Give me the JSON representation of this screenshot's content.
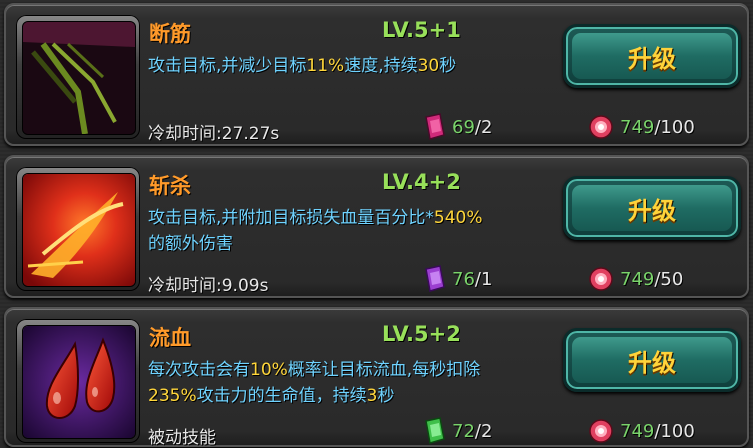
{
  "skills": [
    {
      "name": "断筋",
      "level": "LV.5+1",
      "desc_parts": [
        {
          "text": "攻击目标,并减少目标",
          "hl": false
        },
        {
          "text": "11%",
          "hl": true
        },
        {
          "text": "速度,持续",
          "hl": false
        },
        {
          "text": "30",
          "hl": true
        },
        {
          "text": "秒",
          "hl": false
        }
      ],
      "cooldown": "冷却时间:27.27s",
      "book_color": "#d02a7a",
      "book_have": "69",
      "book_need": "/2",
      "gem_have": "749",
      "gem_need": "/100",
      "button": "升级",
      "icon": "slash-tendon-icon"
    },
    {
      "name": "斩杀",
      "level": "LV.4+2",
      "desc_parts": [
        {
          "text": "攻击目标,并附加目标损失血量百分比*",
          "hl": false
        },
        {
          "text": "540%",
          "hl": true
        },
        {
          "text": "的额外伤害",
          "hl": false
        }
      ],
      "cooldown": "冷却时间:9.09s",
      "book_color": "#9b3fd0",
      "book_have": "76",
      "book_need": "/1",
      "gem_have": "749",
      "gem_need": "/50",
      "button": "升级",
      "icon": "execute-slash-icon"
    },
    {
      "name": "流血",
      "level": "LV.5+2",
      "desc_parts": [
        {
          "text": "每次攻击会有",
          "hl": false
        },
        {
          "text": "10%",
          "hl": true
        },
        {
          "text": "概率让目标流血,每秒扣除",
          "hl": false
        },
        {
          "text": "235%",
          "hl": true
        },
        {
          "text": "攻击力的生命值，持续",
          "hl": false
        },
        {
          "text": "3",
          "hl": true
        },
        {
          "text": "秒",
          "hl": false
        }
      ],
      "cooldown": "被动技能",
      "book_color": "#3fbf4a",
      "book_have": "72",
      "book_need": "/2",
      "gem_have": "749",
      "gem_need": "/100",
      "button": "升级",
      "icon": "blood-drops-icon"
    }
  ]
}
